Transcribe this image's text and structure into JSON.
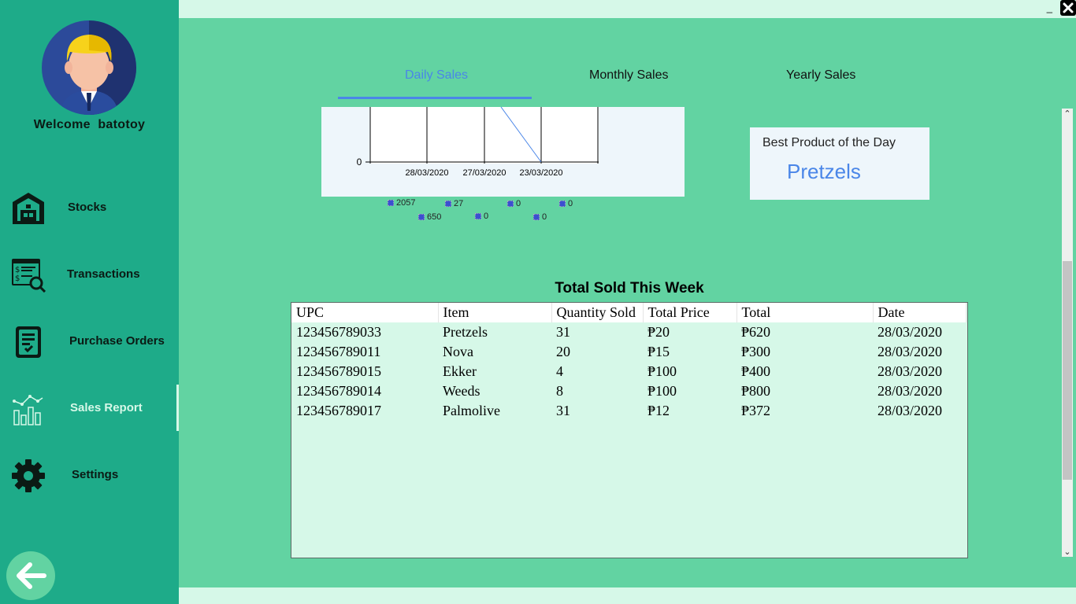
{
  "window": {
    "minimize_label": "_",
    "close_label": "✕"
  },
  "sidebar": {
    "welcome_prefix": "Welcome",
    "username": "batotoy",
    "items": [
      {
        "label": "Stocks",
        "icon": "warehouse-icon"
      },
      {
        "label": "Transactions",
        "icon": "receipt-search-icon"
      },
      {
        "label": "Purchase Orders",
        "icon": "clipboard-check-icon"
      },
      {
        "label": "Sales Report",
        "icon": "bar-line-chart-icon",
        "active": true
      },
      {
        "label": "Settings",
        "icon": "gear-icon"
      }
    ],
    "back_icon": "arrow-left-icon"
  },
  "tabs": [
    {
      "label": "Daily Sales",
      "active": true
    },
    {
      "label": "Monthly Sales"
    },
    {
      "label": "Yearly Sales"
    }
  ],
  "chart_data": {
    "type": "line",
    "x": [
      "28/03/2020",
      "27/03/2020",
      "23/03/2020"
    ],
    "y_tick": "0",
    "legend": [
      {
        "label": "2057"
      },
      {
        "label": "27"
      },
      {
        "label": "0"
      },
      {
        "label": "0"
      },
      {
        "label": "650"
      },
      {
        "label": "0"
      },
      {
        "label": "0"
      }
    ]
  },
  "best_product": {
    "title": "Best Product of the Day",
    "value": "Pretzels"
  },
  "table": {
    "title": "Total Sold This Week",
    "columns": [
      "UPC",
      "Item",
      "Quantity Sold",
      "Total Price",
      "Total",
      "Date"
    ],
    "rows": [
      [
        "123456789033",
        "Pretzels",
        "31",
        "₱20",
        "₱620",
        "28/03/2020"
      ],
      [
        "123456789011",
        "Nova",
        "20",
        "₱15",
        "₱300",
        "28/03/2020"
      ],
      [
        "123456789015",
        "Ekker",
        "4",
        "₱100",
        "₱400",
        "28/03/2020"
      ],
      [
        "123456789014",
        "Weeds",
        "8",
        "₱100",
        "₱800",
        "28/03/2020"
      ],
      [
        "123456789017",
        "Palmolive",
        "31",
        "₱12",
        "₱372",
        "28/03/2020"
      ]
    ]
  },
  "colors": {
    "sidebar": "#1eab89",
    "main": "#62d3a2",
    "accent": "#4a86e8",
    "panel": "#eef6fb"
  }
}
